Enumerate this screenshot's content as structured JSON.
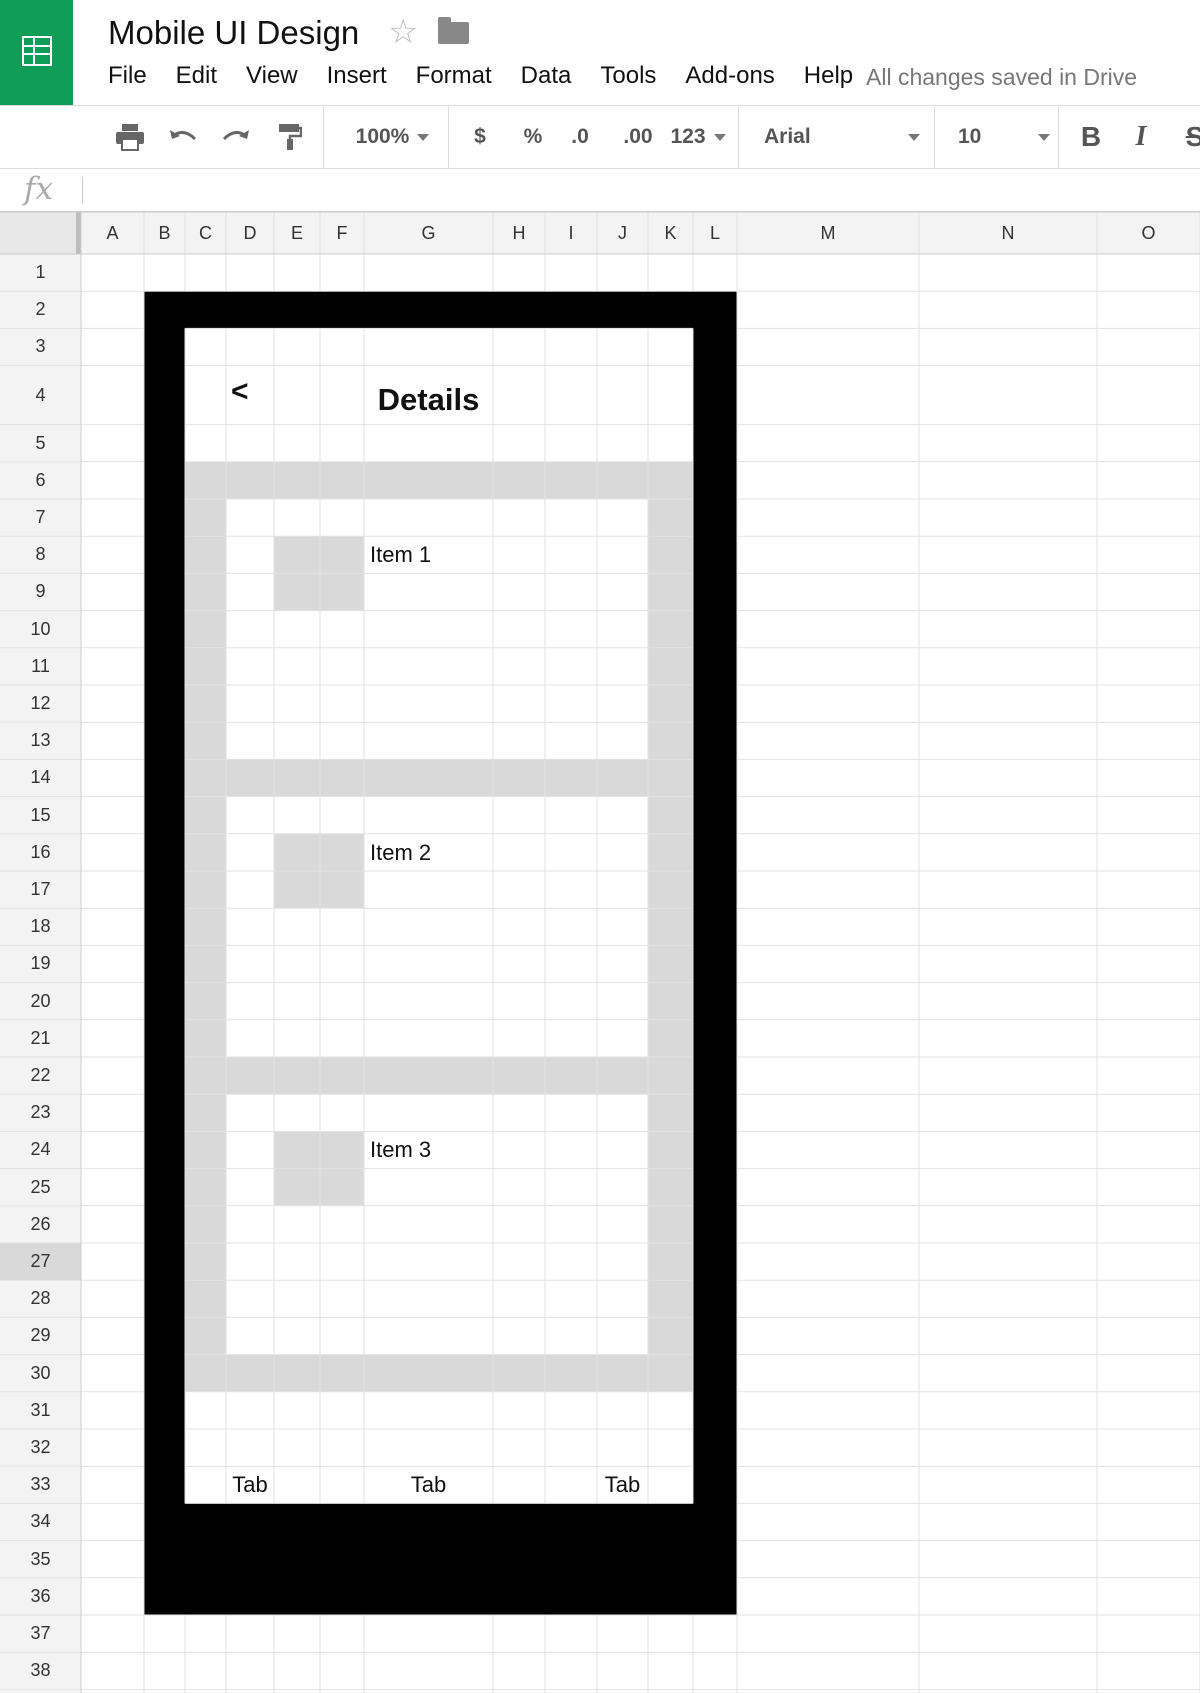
{
  "app": {
    "title": "Mobile UI Design",
    "icons": [
      "sheets-logo-icon",
      "star-icon",
      "folder-icon"
    ],
    "menu": [
      "File",
      "Edit",
      "View",
      "Insert",
      "Format",
      "Data",
      "Tools",
      "Add-ons",
      "Help"
    ],
    "save_status": "All changes saved in Drive"
  },
  "toolbar": {
    "zoom": "100%",
    "currency": "$",
    "percent": "%",
    "decrease_decimals": ".0",
    "increase_decimals": ".00",
    "more_formats": "123",
    "font": "Arial",
    "font_size": "10",
    "bold": "B",
    "italic": "I",
    "strikethrough": "S",
    "icons": [
      "print-icon",
      "undo-icon",
      "redo-icon",
      "paint-format-icon"
    ]
  },
  "formula_bar": {
    "fx_label": "fx",
    "value": ""
  },
  "sheet": {
    "columns": [
      "A",
      "B",
      "C",
      "D",
      "E",
      "F",
      "G",
      "H",
      "I",
      "J",
      "K",
      "L",
      "M",
      "N",
      "O"
    ],
    "rows": [
      "1",
      "2",
      "3",
      "4",
      "5",
      "6",
      "7",
      "8",
      "9",
      "10",
      "11",
      "12",
      "13",
      "14",
      "15",
      "16",
      "17",
      "18",
      "19",
      "20",
      "21",
      "22",
      "23",
      "24",
      "25",
      "26",
      "27",
      "28",
      "29",
      "30",
      "31",
      "32",
      "33",
      "34",
      "35",
      "36",
      "37",
      "38"
    ],
    "selected_row": "27",
    "colors": {
      "frame": "#000000",
      "panel_fill": "#d9d9d9",
      "grid_line": "#e2e2e2",
      "header_bg": "#f3f3f3",
      "brand_green": "#0f9d58"
    }
  },
  "mockup": {
    "back_label": "<",
    "title": "Details",
    "items": [
      "Item 1",
      "Item 2",
      "Item 3"
    ],
    "tabs": [
      "Tab",
      "Tab",
      "Tab"
    ]
  }
}
